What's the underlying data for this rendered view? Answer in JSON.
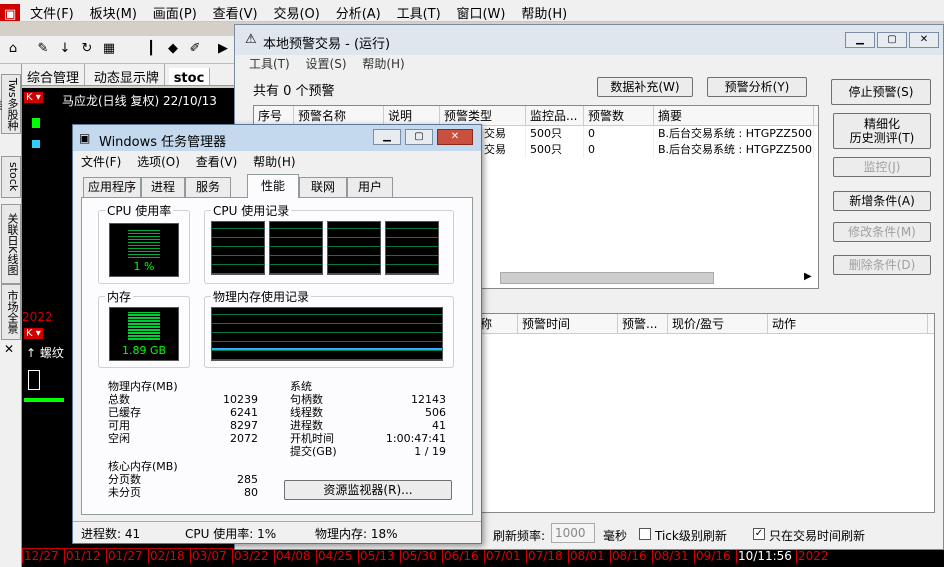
{
  "menubar": [
    "文件(F)",
    "板块(M)",
    "画面(P)",
    "查看(V)",
    "交易(O)",
    "分析(A)",
    "工具(T)",
    "窗口(W)",
    "帮助(H)"
  ],
  "apptabs": [
    "综合管理",
    "动态显示牌",
    "stoc"
  ],
  "lefttabs": [
    "Tws多股种类",
    "stock",
    "关联日K线图",
    "市场全景"
  ],
  "chart": {
    "stock1": "马应龙(日线 复权) 22/10/13",
    "year": "2022",
    "stock2": "螺纹"
  },
  "dates": [
    "12/27",
    "01/12",
    "01/27",
    "02/18",
    "03/07",
    "03/22",
    "04/08",
    "04/25",
    "05/13",
    "05/30",
    "06/16",
    "07/01",
    "07/18",
    "08/01",
    "08/16",
    "08/31",
    "09/16",
    "10/11:56",
    "2022"
  ],
  "warn": {
    "title": "本地预警交易 - (运行)",
    "menu": [
      "工具(T)",
      "设置(S)",
      "帮助(H)"
    ],
    "count": "共有 0 个预警",
    "btn_fill": "数据补充(W)",
    "btn_analysis": "预警分析(Y)",
    "side": [
      "停止预警(S)",
      "精细化\n历史测评(T)",
      "监控(J)",
      "新增条件(A)",
      "修改条件(M)",
      "删除条件(D)"
    ],
    "grid1_headers": [
      "序号",
      "预警名称",
      "说明",
      "预警类型",
      "监控品...",
      "预警数",
      "摘要"
    ],
    "grid1_rows": [
      [
        "交易",
        "500只",
        "0",
        "B.后台交易系统 : HTGPZZ500"
      ],
      [
        "交易",
        "500只",
        "0",
        "B.后台交易系统 : HTGPZZ500"
      ]
    ],
    "grid2_headers": [
      "称",
      "预警时间",
      "预警...",
      "现价/盈亏",
      "动作"
    ],
    "refresh_label": "刷新频率:",
    "refresh_value": "1000",
    "refresh_unit": "毫秒",
    "tick_label": "Tick级别刷新",
    "only_label": "只在交易时间刷新"
  },
  "tm": {
    "title": "Windows 任务管理器",
    "menu": [
      "文件(F)",
      "选项(O)",
      "查看(V)",
      "帮助(H)"
    ],
    "tabs": [
      "应用程序",
      "进程",
      "服务",
      "性能",
      "联网",
      "用户"
    ],
    "cpu_label": "CPU 使用率",
    "cpu_value": "1 %",
    "cpu_hist_label": "CPU 使用记录",
    "mem_label": "内存",
    "mem_value": "1.89 GB",
    "mem_hist_label": "物理内存使用记录",
    "phys_title": "物理内存(MB)",
    "phys": [
      [
        "总数",
        "10239"
      ],
      [
        "已缓存",
        "6241"
      ],
      [
        "可用",
        "8297"
      ],
      [
        "空闲",
        "2072"
      ]
    ],
    "sys_title": "系统",
    "sys": [
      [
        "句柄数",
        "12143"
      ],
      [
        "线程数",
        "506"
      ],
      [
        "进程数",
        "41"
      ],
      [
        "开机时间",
        "1:00:47:41"
      ],
      [
        "提交(GB)",
        "1 / 19"
      ]
    ],
    "kernel_title": "核心内存(MB)",
    "kernel": [
      [
        "分页数",
        "285"
      ],
      [
        "未分页",
        "80"
      ]
    ],
    "resmon": "资源监视器(R)...",
    "status_proc": "进程数: 41",
    "status_cpu": "CPU 使用率: 1%",
    "status_mem": "物理内存: 18%"
  }
}
